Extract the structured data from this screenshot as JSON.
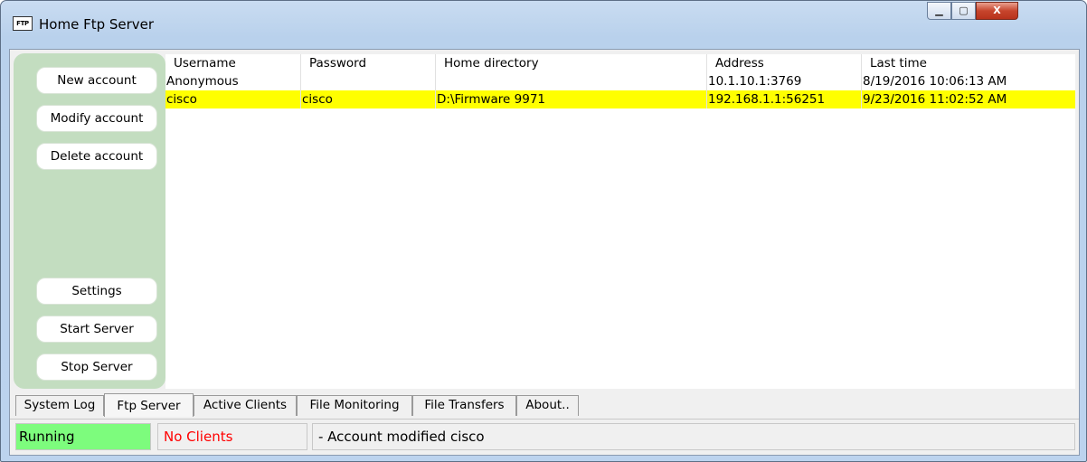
{
  "window": {
    "icon_text": "FTP",
    "title": "Home Ftp Server",
    "controls": {
      "minimize": "▁",
      "maximize": "▢",
      "close": "X"
    }
  },
  "sidebar": {
    "top_buttons": [
      "New account",
      "Modify account",
      "Delete account"
    ],
    "bottom_buttons": [
      "Settings",
      "Start Server",
      "Stop Server"
    ]
  },
  "table": {
    "columns": [
      "Username",
      "Password",
      "Home directory",
      "Address",
      "Last time"
    ],
    "rows": [
      [
        "Anonymous",
        "",
        "",
        "10.1.10.1:3769",
        "8/19/2016 10:06:13 AM"
      ],
      [
        "cisco",
        "cisco",
        "D:\\Firmware 9971",
        "192.168.1.1:56251",
        "9/23/2016 11:02:52 AM"
      ]
    ],
    "selected_row": 1
  },
  "tabs": [
    "System Log",
    "Ftp Server",
    "Active Clients",
    "File Monitoring",
    "File Transfers",
    "About.."
  ],
  "active_tab": 1,
  "status": {
    "state": "Running",
    "clients": "No Clients",
    "message": "- Account modified cisco"
  },
  "colors": {
    "running_bg": "#7dfc7d",
    "clients_text": "#ff0000",
    "selected_row_bg": "#ffff00",
    "panel_bg": "#c3ddc0"
  }
}
